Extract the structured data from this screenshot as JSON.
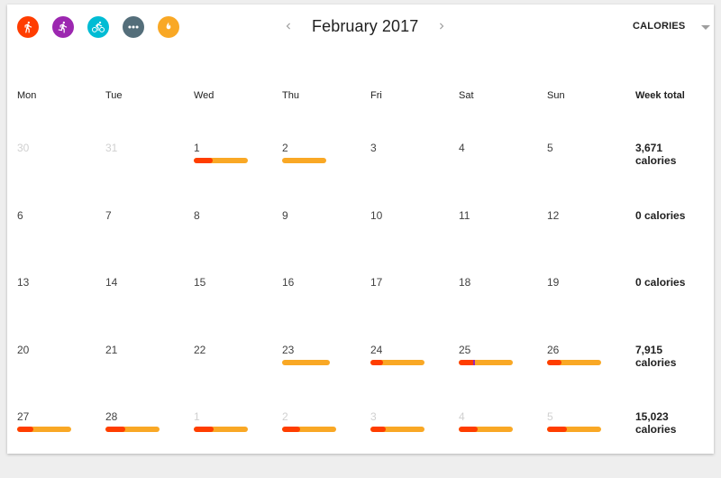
{
  "header": {
    "activity_filters": [
      {
        "name": "walking",
        "icon": "walking-icon",
        "color": "#ff3d00"
      },
      {
        "name": "running",
        "icon": "running-icon",
        "color": "#9c27b0"
      },
      {
        "name": "biking",
        "icon": "biking-icon",
        "color": "#00bcd4"
      },
      {
        "name": "other",
        "icon": "more-icon",
        "color": "#546e7a"
      },
      {
        "name": "calories",
        "icon": "flame-icon",
        "color": "#f9a825"
      }
    ],
    "month_title": "February 2017",
    "prev_icon": "chevron-left-icon",
    "next_icon": "chevron-right-icon",
    "metric_selector": "CALORIES"
  },
  "columns": [
    "Mon",
    "Tue",
    "Wed",
    "Thu",
    "Fri",
    "Sat",
    "Sun",
    "Week total"
  ],
  "colors": {
    "bar_base": "#f9a825",
    "walking": "#ff3d00",
    "running": "#9c27b0"
  },
  "weeks": [
    {
      "days": [
        {
          "num": "30",
          "other_month": true
        },
        {
          "num": "31",
          "other_month": true
        },
        {
          "num": "1",
          "bar": {
            "total": 1.0,
            "walking": 0.35,
            "running": 0
          }
        },
        {
          "num": "2",
          "bar": {
            "total": 0.82,
            "walking": 0,
            "running": 0
          }
        },
        {
          "num": "3"
        },
        {
          "num": "4"
        },
        {
          "num": "5"
        }
      ],
      "total": "3,671 calories"
    },
    {
      "days": [
        {
          "num": "6"
        },
        {
          "num": "7"
        },
        {
          "num": "8"
        },
        {
          "num": "9"
        },
        {
          "num": "10"
        },
        {
          "num": "11"
        },
        {
          "num": "12"
        }
      ],
      "total": "0 calories"
    },
    {
      "days": [
        {
          "num": "13"
        },
        {
          "num": "14"
        },
        {
          "num": "15"
        },
        {
          "num": "16"
        },
        {
          "num": "17"
        },
        {
          "num": "18"
        },
        {
          "num": "19"
        }
      ],
      "total": "0 calories"
    },
    {
      "days": [
        {
          "num": "20"
        },
        {
          "num": "21"
        },
        {
          "num": "22"
        },
        {
          "num": "23",
          "bar": {
            "total": 0.88,
            "walking": 0,
            "running": 0
          }
        },
        {
          "num": "24",
          "bar": {
            "total": 1.0,
            "walking": 0.23,
            "running": 0
          }
        },
        {
          "num": "25",
          "bar": {
            "total": 1.0,
            "walking": 0.3,
            "running": 0.04
          }
        },
        {
          "num": "26",
          "bar": {
            "total": 1.0,
            "walking": 0.27,
            "running": 0
          }
        }
      ],
      "total": "7,915 calories"
    },
    {
      "days": [
        {
          "num": "27",
          "bar": {
            "total": 1.0,
            "walking": 0.3,
            "running": 0
          }
        },
        {
          "num": "28",
          "bar": {
            "total": 1.0,
            "walking": 0.37,
            "running": 0
          }
        },
        {
          "num": "1",
          "other_month": true,
          "bar": {
            "total": 1.0,
            "walking": 0.37,
            "running": 0
          }
        },
        {
          "num": "2",
          "other_month": true,
          "bar": {
            "total": 1.0,
            "walking": 0.33,
            "running": 0
          }
        },
        {
          "num": "3",
          "other_month": true,
          "bar": {
            "total": 1.0,
            "walking": 0.28,
            "running": 0
          }
        },
        {
          "num": "4",
          "other_month": true,
          "bar": {
            "total": 1.0,
            "walking": 0.35,
            "running": 0
          }
        },
        {
          "num": "5",
          "other_month": true,
          "bar": {
            "total": 1.0,
            "walking": 0.37,
            "running": 0
          }
        }
      ],
      "total": "15,023 calories"
    }
  ]
}
